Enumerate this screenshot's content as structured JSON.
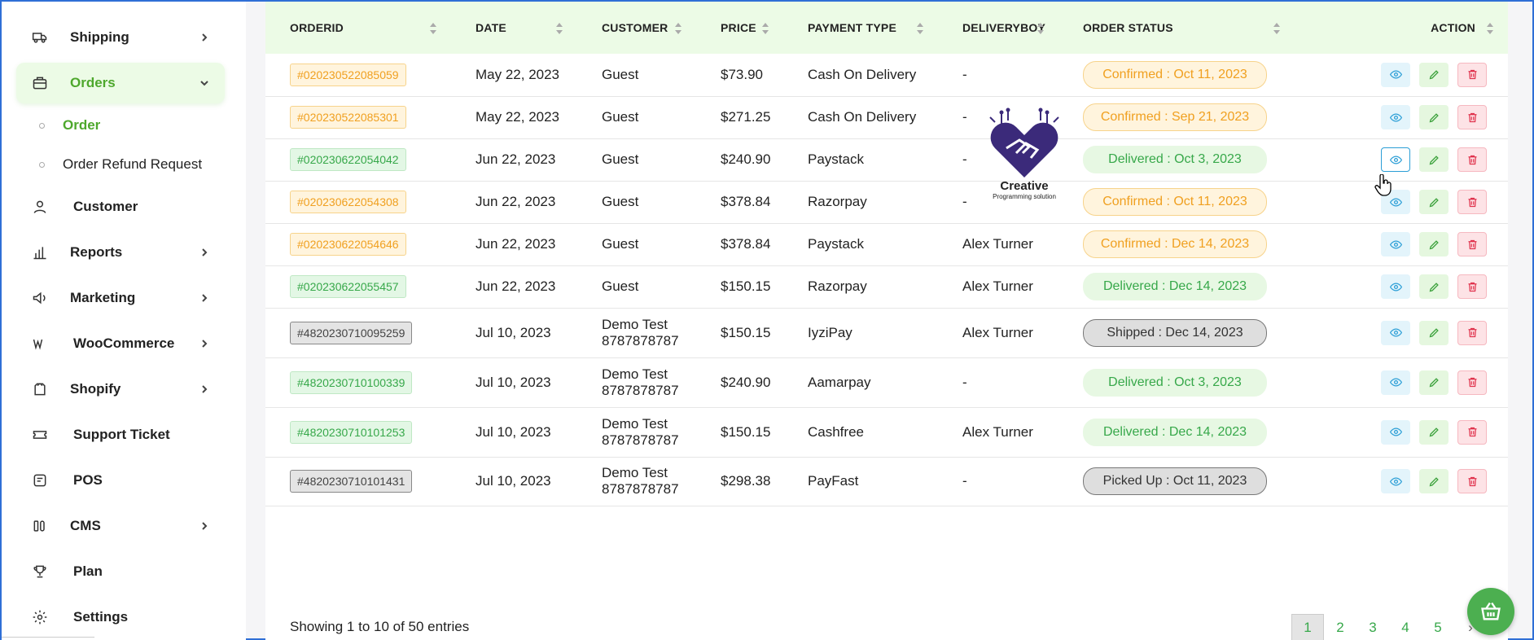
{
  "sidebar": {
    "items": [
      {
        "label": "Shipping",
        "icon": "truck-icon",
        "chevron": "right"
      },
      {
        "label": "Orders",
        "icon": "briefcase-icon",
        "chevron": "down",
        "active": true
      },
      {
        "label": "Customer",
        "icon": "user-icon"
      },
      {
        "label": "Reports",
        "icon": "bar-chart-icon",
        "chevron": "right"
      },
      {
        "label": "Marketing",
        "icon": "megaphone-icon",
        "chevron": "right"
      },
      {
        "label": "WooCommerce",
        "icon": "woocommerce-icon",
        "chevron": "right"
      },
      {
        "label": "Shopify",
        "icon": "shopify-icon",
        "chevron": "right"
      },
      {
        "label": "Support Ticket",
        "icon": "ticket-icon"
      },
      {
        "label": "POS",
        "icon": "pos-icon"
      },
      {
        "label": "CMS",
        "icon": "cms-icon",
        "chevron": "right"
      },
      {
        "label": "Plan",
        "icon": "trophy-icon"
      },
      {
        "label": "Settings",
        "icon": "gear-icon"
      }
    ],
    "subitems": [
      {
        "label": "Order",
        "active": true
      },
      {
        "label": "Order Refund Request"
      }
    ]
  },
  "table": {
    "headers": {
      "orderid": "ORDERID",
      "date": "DATE",
      "customer": "CUSTOMER",
      "price": "PRICE",
      "payment": "PAYMENT TYPE",
      "deliveryboy": "DELIVERYBOY",
      "status": "ORDER STATUS",
      "action": "ACTION"
    },
    "rows": [
      {
        "orderid": "#020230522085059",
        "date": "May 22, 2023",
        "customer": "Guest",
        "customer_phone": "",
        "price": "$73.90",
        "payment": "Cash On Delivery",
        "deliveryboy": "-",
        "status": "Confirmed : Oct 11, 2023"
      },
      {
        "orderid": "#020230522085301",
        "date": "May 22, 2023",
        "customer": "Guest",
        "customer_phone": "",
        "price": "$271.25",
        "payment": "Cash On Delivery",
        "deliveryboy": "-",
        "status": "Confirmed : Sep 21, 2023"
      },
      {
        "orderid": "#020230622054042",
        "date": "Jun 22, 2023",
        "customer": "Guest",
        "customer_phone": "",
        "price": "$240.90",
        "payment": "Paystack",
        "deliveryboy": "-",
        "status": "Delivered : Oct 3, 2023"
      },
      {
        "orderid": "#020230622054308",
        "date": "Jun 22, 2023",
        "customer": "Guest",
        "customer_phone": "",
        "price": "$378.84",
        "payment": "Razorpay",
        "deliveryboy": "-",
        "status": "Confirmed : Oct 11, 2023"
      },
      {
        "orderid": "#020230622054646",
        "date": "Jun 22, 2023",
        "customer": "Guest",
        "customer_phone": "",
        "price": "$378.84",
        "payment": "Paystack",
        "deliveryboy": "Alex Turner",
        "status": "Confirmed : Dec 14, 2023"
      },
      {
        "orderid": "#020230622055457",
        "date": "Jun 22, 2023",
        "customer": "Guest",
        "customer_phone": "",
        "price": "$150.15",
        "payment": "Razorpay",
        "deliveryboy": "Alex Turner",
        "status": "Delivered : Dec 14, 2023"
      },
      {
        "orderid": "#4820230710095259",
        "date": "Jul 10, 2023",
        "customer": "Demo Test",
        "customer_phone": "8787878787",
        "price": "$150.15",
        "payment": "IyziPay",
        "deliveryboy": "Alex Turner",
        "status": "Shipped : Dec 14, 2023"
      },
      {
        "orderid": "#4820230710100339",
        "date": "Jul 10, 2023",
        "customer": "Demo Test",
        "customer_phone": "8787878787",
        "price": "$240.90",
        "payment": "Aamarpay",
        "deliveryboy": "-",
        "status": "Delivered : Oct 3, 2023"
      },
      {
        "orderid": "#4820230710101253",
        "date": "Jul 10, 2023",
        "customer": "Demo Test",
        "customer_phone": "8787878787",
        "price": "$150.15",
        "payment": "Cashfree",
        "deliveryboy": "Alex Turner",
        "status": "Delivered : Dec 14, 2023"
      },
      {
        "orderid": "#4820230710101431",
        "date": "Jul 10, 2023",
        "customer": "Demo Test",
        "customer_phone": "8787878787",
        "price": "$298.38",
        "payment": "PayFast",
        "deliveryboy": "-",
        "status": "Picked Up : Oct 11, 2023"
      }
    ]
  },
  "footer": {
    "showing": "Showing 1 to 10 of 50 entries",
    "pages": [
      "1",
      "2",
      "3",
      "4",
      "5"
    ],
    "next": "›"
  },
  "logo": {
    "title": "Creative",
    "subtitle": "Programming solution"
  },
  "colors": {
    "accent": "#4ea82d",
    "confirmed": "#f0a020",
    "delivered": "#37a84a",
    "view": "#2b9ed6",
    "delete": "#e0334d",
    "header_bg": "#ecfbe6"
  }
}
